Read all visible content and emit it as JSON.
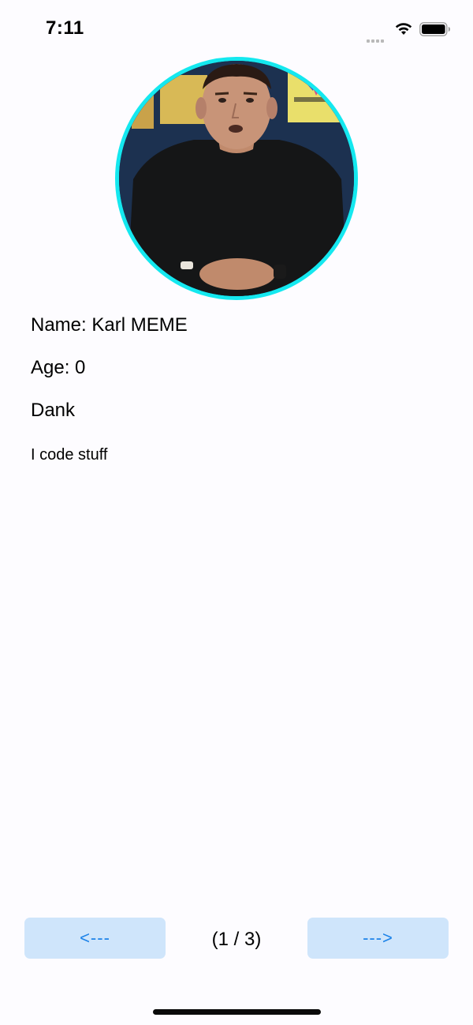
{
  "status_bar": {
    "time": "7:11",
    "icons": [
      "cellular-signal-icon",
      "wifi-icon",
      "battery-icon"
    ]
  },
  "profile": {
    "avatar_alt": "profile photo",
    "name_line": "Name: Karl MEME",
    "age_line": "Age: 0",
    "tag_line": "Dank",
    "bio_line": "I code stuff"
  },
  "pager": {
    "prev_label": "<---",
    "next_label": "--->",
    "indicator": "(1 / 3)",
    "current_page": 1,
    "total_pages": 3
  },
  "colors": {
    "background": "#fdfcff",
    "avatar_border": "#14e8ef",
    "button_background": "#cfe5fb",
    "button_text": "#1c82e8"
  }
}
